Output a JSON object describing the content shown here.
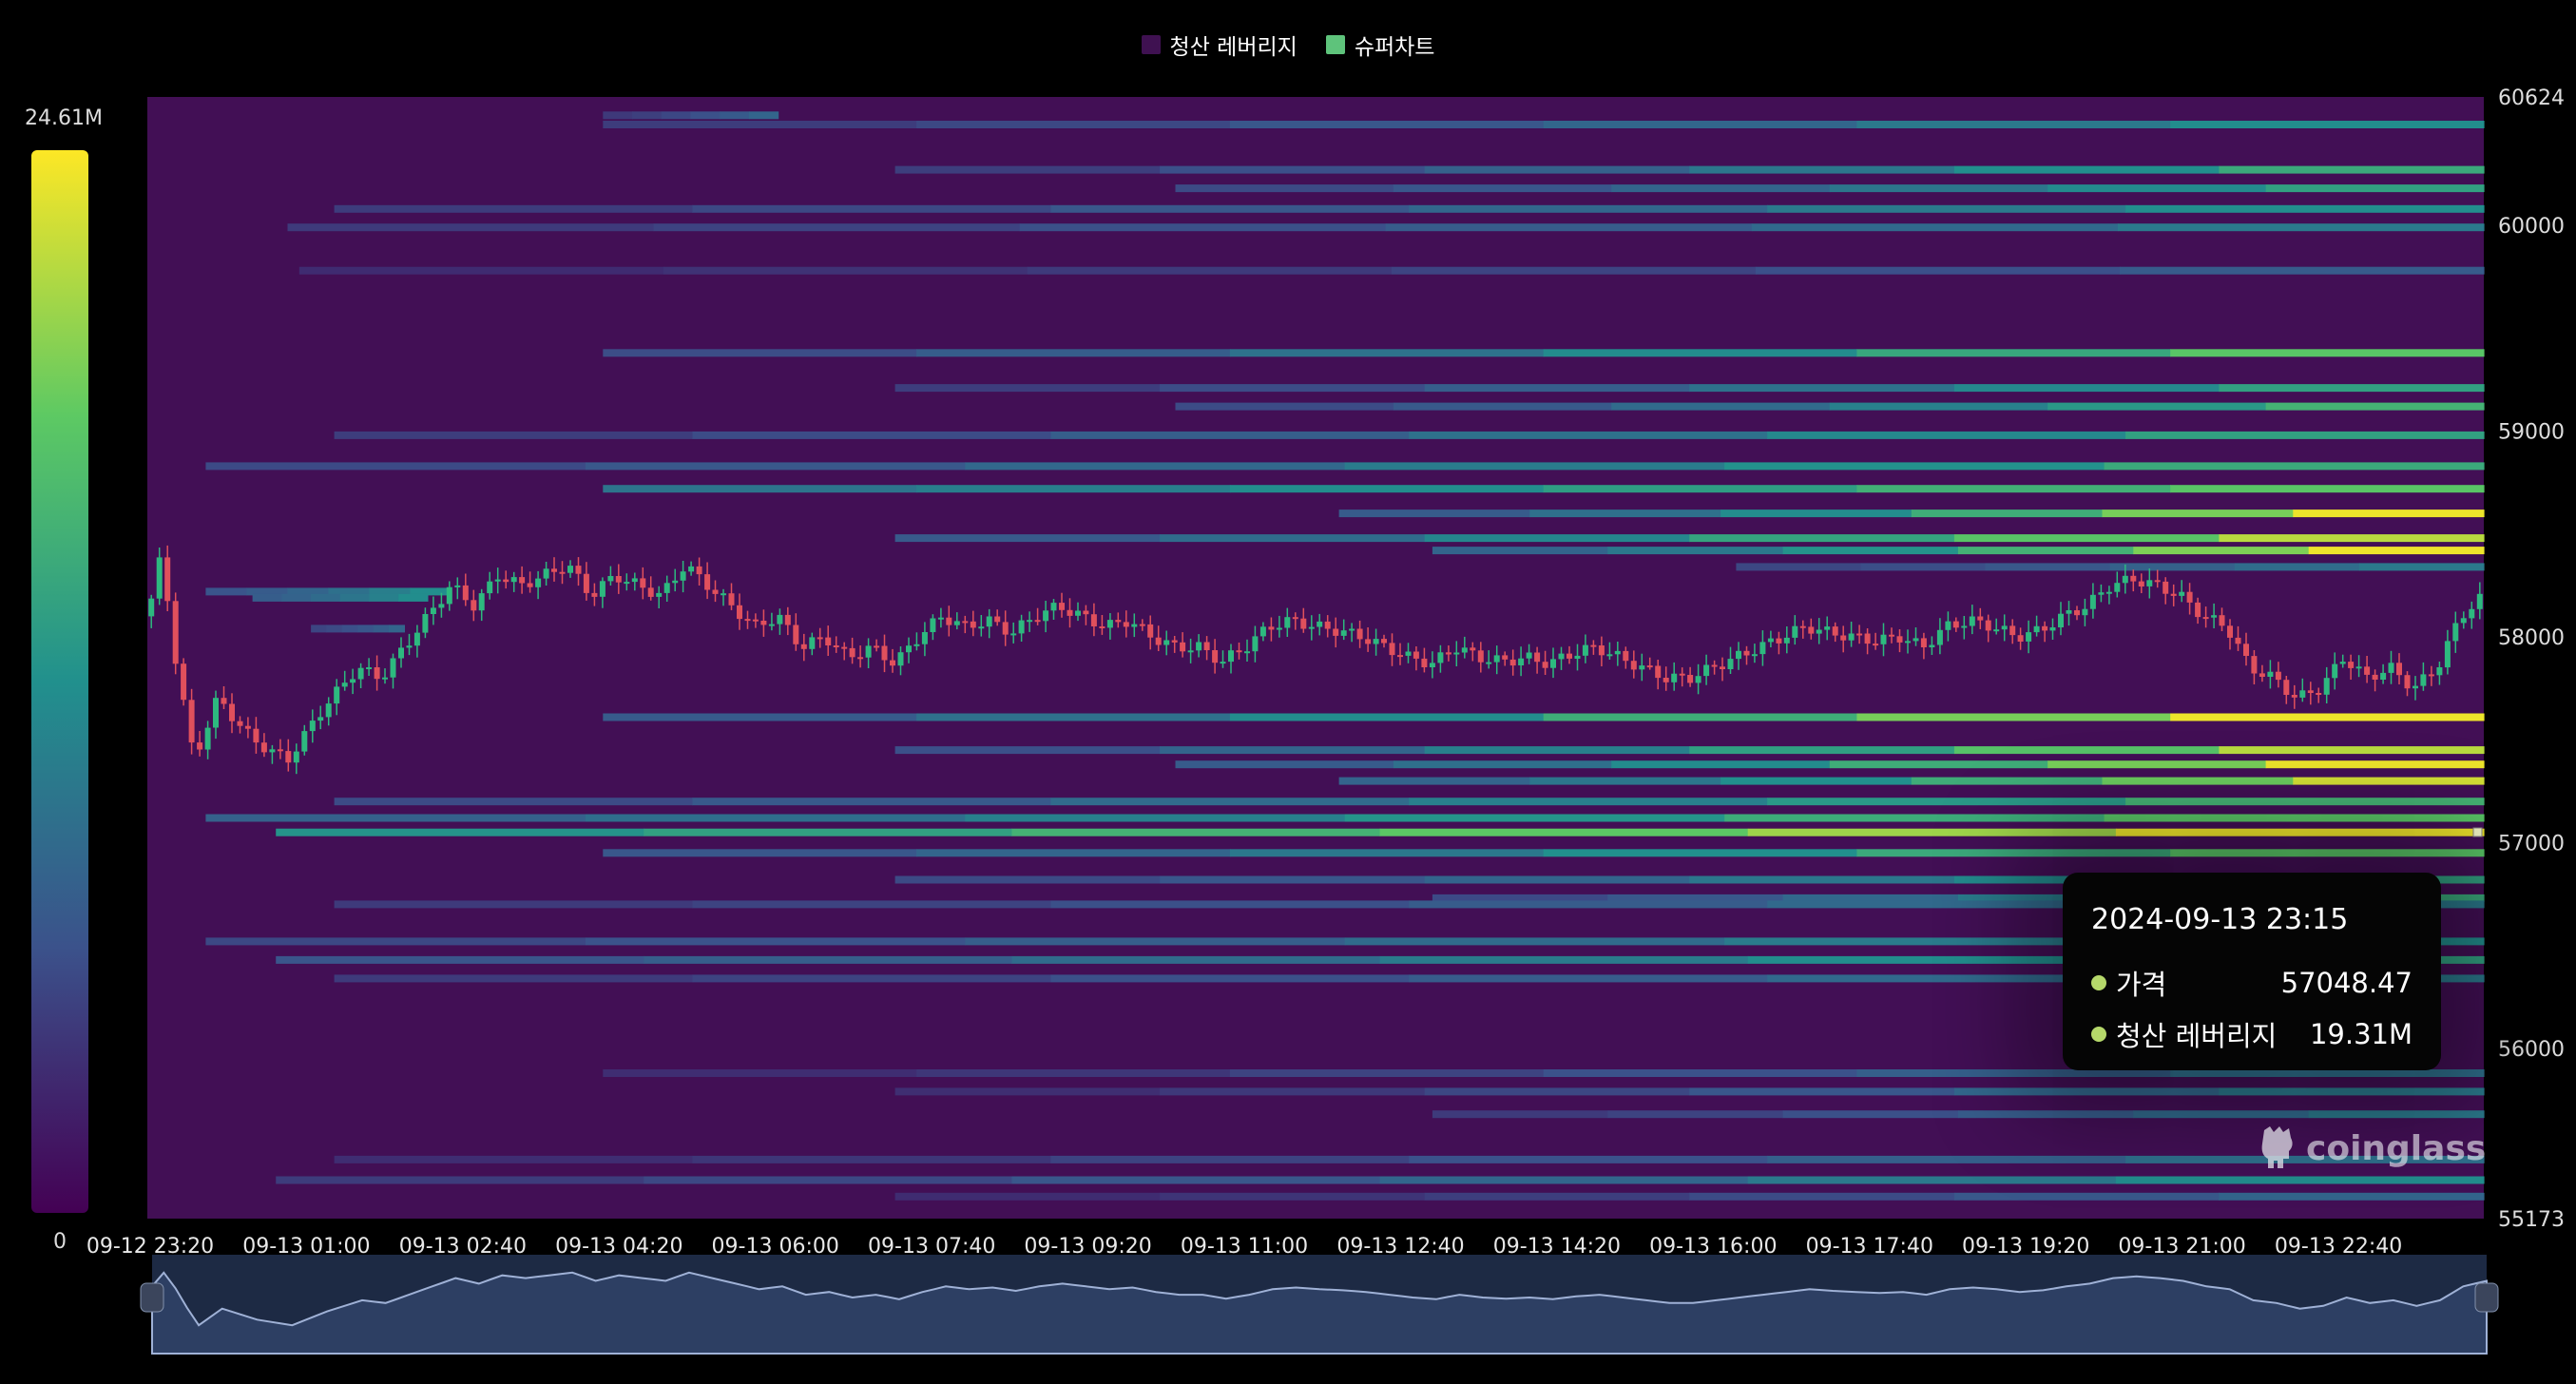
{
  "legend": {
    "items": [
      {
        "label": "청산 레버리지",
        "color": "#3f1151"
      },
      {
        "label": "슈퍼차트",
        "color": "#5ec37b"
      }
    ]
  },
  "tooltip": {
    "time": "2024-09-13 23:15",
    "rows": [
      {
        "label": "가격",
        "value": "57048.47",
        "dot_color": "#b5d86a"
      },
      {
        "label": "청산 레버리지",
        "value": "19.31M",
        "dot_color": "#b5d86a"
      }
    ]
  },
  "color_scale": {
    "max_label": "24.61M",
    "min_label": "0",
    "stops": [
      "#440154",
      "#3b528b",
      "#21908d",
      "#5dc963",
      "#fde725"
    ]
  },
  "watermark": {
    "text": "coinglass",
    "icon": "coinglass-logo-icon"
  },
  "colors": {
    "up": "#2db97f",
    "down": "#e0505c",
    "background": "#420f55"
  },
  "chart_data": {
    "type": "heatmap",
    "title": "",
    "x_ticks": [
      "09-12 23:20",
      "09-13 01:00",
      "09-13 02:40",
      "09-13 04:20",
      "09-13 06:00",
      "09-13 07:40",
      "09-13 09:20",
      "09-13 11:00",
      "09-13 12:40",
      "09-13 14:20",
      "09-13 16:00",
      "09-13 17:40",
      "09-13 19:20",
      "09-13 21:00",
      "09-13 22:40"
    ],
    "y_ticks": [
      60624,
      60000,
      59000,
      58000,
      57000,
      56000,
      55173
    ],
    "y_range": [
      55173,
      60624
    ],
    "color_range": [
      0,
      24.61
    ],
    "color_unit": "M",
    "series": [
      {
        "name": "청산 레버리지",
        "type": "heatmap-bands",
        "bands": [
          {
            "price": 60535,
            "start": 0.195,
            "end": 0.27,
            "value": [
              4,
              8
            ]
          },
          {
            "price": 60490,
            "start": 0.195,
            "end": 1.0,
            "value": [
              4,
              12
            ]
          },
          {
            "price": 60270,
            "start": 0.32,
            "end": 1.0,
            "value": [
              4,
              15
            ]
          },
          {
            "price": 60180,
            "start": 0.44,
            "end": 1.0,
            "value": [
              5,
              14
            ]
          },
          {
            "price": 60080,
            "start": 0.08,
            "end": 1.0,
            "value": [
              4,
              12
            ]
          },
          {
            "price": 59990,
            "start": 0.06,
            "end": 1.0,
            "value": [
              4,
              10
            ]
          },
          {
            "price": 59780,
            "start": 0.065,
            "end": 1.0,
            "value": [
              3,
              7
            ]
          },
          {
            "price": 59380,
            "start": 0.195,
            "end": 1.0,
            "value": [
              5,
              18
            ]
          },
          {
            "price": 59210,
            "start": 0.32,
            "end": 1.0,
            "value": [
              4,
              14
            ]
          },
          {
            "price": 59120,
            "start": 0.44,
            "end": 1.0,
            "value": [
              5,
              16
            ]
          },
          {
            "price": 58980,
            "start": 0.08,
            "end": 1.0,
            "value": [
              4,
              14
            ]
          },
          {
            "price": 58830,
            "start": 0.025,
            "end": 1.0,
            "value": [
              5,
              15
            ]
          },
          {
            "price": 58720,
            "start": 0.195,
            "end": 1.0,
            "value": [
              9,
              18
            ]
          },
          {
            "price": 58600,
            "start": 0.51,
            "end": 1.0,
            "value": [
              6,
              24
            ]
          },
          {
            "price": 58480,
            "start": 0.32,
            "end": 1.0,
            "value": [
              6,
              22
            ]
          },
          {
            "price": 58420,
            "start": 0.55,
            "end": 1.0,
            "value": [
              7,
              24
            ]
          },
          {
            "price": 58340,
            "start": 0.68,
            "end": 1.0,
            "value": [
              5,
              10
            ]
          },
          {
            "price": 58220,
            "start": 0.025,
            "end": 0.13,
            "value": [
              6,
              12
            ]
          },
          {
            "price": 58190,
            "start": 0.045,
            "end": 0.12,
            "value": [
              7,
              12
            ]
          },
          {
            "price": 58040,
            "start": 0.07,
            "end": 0.11,
            "value": [
              5,
              8
            ]
          },
          {
            "price": 57610,
            "start": 0.195,
            "end": 1.0,
            "value": [
              6,
              24
            ]
          },
          {
            "price": 57450,
            "start": 0.32,
            "end": 1.0,
            "value": [
              5,
              22
            ]
          },
          {
            "price": 57380,
            "start": 0.44,
            "end": 1.0,
            "value": [
              6,
              24
            ]
          },
          {
            "price": 57300,
            "start": 0.51,
            "end": 1.0,
            "value": [
              7,
              23
            ]
          },
          {
            "price": 57200,
            "start": 0.08,
            "end": 1.0,
            "value": [
              5,
              16
            ]
          },
          {
            "price": 57120,
            "start": 0.025,
            "end": 1.0,
            "value": [
              7,
              18
            ]
          },
          {
            "price": 57050,
            "start": 0.055,
            "end": 1.0,
            "value": [
              12,
              24
            ]
          },
          {
            "price": 56950,
            "start": 0.195,
            "end": 1.0,
            "value": [
              6,
              18
            ]
          },
          {
            "price": 56820,
            "start": 0.32,
            "end": 1.0,
            "value": [
              5,
              14
            ]
          },
          {
            "price": 56730,
            "start": 0.55,
            "end": 1.0,
            "value": [
              5,
              15
            ]
          },
          {
            "price": 56700,
            "start": 0.08,
            "end": 1.0,
            "value": [
              4,
              10
            ]
          },
          {
            "price": 56520,
            "start": 0.025,
            "end": 1.0,
            "value": [
              5,
              12
            ]
          },
          {
            "price": 56430,
            "start": 0.055,
            "end": 1.0,
            "value": [
              6,
              14
            ]
          },
          {
            "price": 56340,
            "start": 0.08,
            "end": 1.0,
            "value": [
              4,
              10
            ]
          },
          {
            "price": 55880,
            "start": 0.195,
            "end": 1.0,
            "value": [
              3,
              9
            ]
          },
          {
            "price": 55790,
            "start": 0.32,
            "end": 1.0,
            "value": [
              3,
              10
            ]
          },
          {
            "price": 55680,
            "start": 0.55,
            "end": 1.0,
            "value": [
              4,
              10
            ]
          },
          {
            "price": 55460,
            "start": 0.08,
            "end": 1.0,
            "value": [
              3,
              9
            ]
          },
          {
            "price": 55360,
            "start": 0.055,
            "end": 1.0,
            "value": [
              4,
              12
            ]
          },
          {
            "price": 55280,
            "start": 0.32,
            "end": 1.0,
            "value": [
              3,
              8
            ]
          }
        ]
      },
      {
        "name": "가격",
        "type": "price-path",
        "points": [
          [
            0,
            58100
          ],
          [
            0.006,
            58400
          ],
          [
            0.012,
            57900
          ],
          [
            0.02,
            57400
          ],
          [
            0.03,
            57700
          ],
          [
            0.045,
            57500
          ],
          [
            0.06,
            57400
          ],
          [
            0.075,
            57650
          ],
          [
            0.09,
            57850
          ],
          [
            0.1,
            57800
          ],
          [
            0.11,
            57950
          ],
          [
            0.12,
            58100
          ],
          [
            0.13,
            58250
          ],
          [
            0.14,
            58150
          ],
          [
            0.15,
            58300
          ],
          [
            0.16,
            58250
          ],
          [
            0.17,
            58300
          ],
          [
            0.18,
            58350
          ],
          [
            0.19,
            58200
          ],
          [
            0.2,
            58300
          ],
          [
            0.21,
            58250
          ],
          [
            0.22,
            58200
          ],
          [
            0.23,
            58350
          ],
          [
            0.24,
            58250
          ],
          [
            0.25,
            58150
          ],
          [
            0.26,
            58050
          ],
          [
            0.27,
            58100
          ],
          [
            0.28,
            57950
          ],
          [
            0.29,
            58000
          ],
          [
            0.3,
            57900
          ],
          [
            0.31,
            57950
          ],
          [
            0.32,
            57870
          ],
          [
            0.33,
            58000
          ],
          [
            0.34,
            58100
          ],
          [
            0.35,
            58050
          ],
          [
            0.36,
            58080
          ],
          [
            0.37,
            58020
          ],
          [
            0.38,
            58100
          ],
          [
            0.39,
            58150
          ],
          [
            0.4,
            58100
          ],
          [
            0.41,
            58050
          ],
          [
            0.42,
            58080
          ],
          [
            0.43,
            58000
          ],
          [
            0.44,
            57950
          ],
          [
            0.45,
            57950
          ],
          [
            0.46,
            57880
          ],
          [
            0.47,
            57950
          ],
          [
            0.48,
            58050
          ],
          [
            0.49,
            58080
          ],
          [
            0.5,
            58050
          ],
          [
            0.51,
            58030
          ],
          [
            0.52,
            58000
          ],
          [
            0.53,
            57950
          ],
          [
            0.54,
            57900
          ],
          [
            0.55,
            57870
          ],
          [
            0.56,
            57950
          ],
          [
            0.57,
            57900
          ],
          [
            0.58,
            57880
          ],
          [
            0.59,
            57900
          ],
          [
            0.6,
            57870
          ],
          [
            0.61,
            57920
          ],
          [
            0.62,
            57950
          ],
          [
            0.63,
            57900
          ],
          [
            0.64,
            57850
          ],
          [
            0.65,
            57800
          ],
          [
            0.66,
            57800
          ],
          [
            0.67,
            57850
          ],
          [
            0.68,
            57900
          ],
          [
            0.69,
            57950
          ],
          [
            0.7,
            58000
          ],
          [
            0.71,
            58050
          ],
          [
            0.72,
            58020
          ],
          [
            0.73,
            58000
          ],
          [
            0.74,
            57980
          ],
          [
            0.75,
            58000
          ],
          [
            0.76,
            57950
          ],
          [
            0.77,
            58050
          ],
          [
            0.78,
            58080
          ],
          [
            0.79,
            58050
          ],
          [
            0.8,
            58000
          ],
          [
            0.81,
            58030
          ],
          [
            0.82,
            58100
          ],
          [
            0.83,
            58150
          ],
          [
            0.84,
            58250
          ],
          [
            0.85,
            58280
          ],
          [
            0.86,
            58250
          ],
          [
            0.87,
            58200
          ],
          [
            0.88,
            58100
          ],
          [
            0.89,
            58050
          ],
          [
            0.9,
            57850
          ],
          [
            0.91,
            57800
          ],
          [
            0.92,
            57700
          ],
          [
            0.93,
            57750
          ],
          [
            0.94,
            57900
          ],
          [
            0.95,
            57800
          ],
          [
            0.96,
            57850
          ],
          [
            0.97,
            57750
          ],
          [
            0.98,
            57850
          ],
          [
            0.99,
            58100
          ],
          [
            1.0,
            58200
          ]
        ]
      }
    ]
  }
}
